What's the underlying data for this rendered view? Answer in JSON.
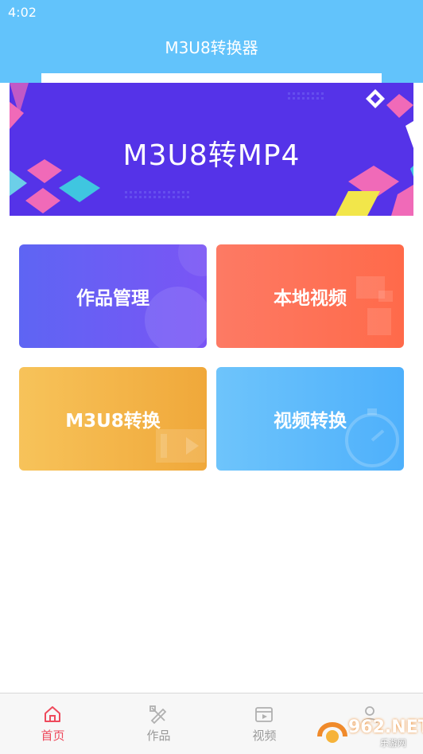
{
  "status_bar": {
    "time": "4:02"
  },
  "header": {
    "title": "M3U8转换器"
  },
  "banner": {
    "title": "M3U8转MP4"
  },
  "cards": [
    {
      "label": "作品管理",
      "color": "#6a5ff4"
    },
    {
      "label": "本地视频",
      "color": "#fe7257"
    },
    {
      "label": "M3U8转换",
      "color": "#f4b84a"
    },
    {
      "label": "视频转换",
      "color": "#5ebafb"
    }
  ],
  "tabbar": {
    "items": [
      {
        "label": "首页",
        "icon": "home-icon",
        "active": true
      },
      {
        "label": "作品",
        "icon": "works-icon",
        "active": false
      },
      {
        "label": "视频",
        "icon": "video-icon",
        "active": false
      },
      {
        "label": "",
        "icon": "user-icon",
        "active": false
      }
    ]
  },
  "watermark": {
    "text": "962.NET",
    "sub": "乐游网"
  },
  "colors": {
    "header": "#62c3fb",
    "banner": "#5533e8",
    "active_tab": "#ee4a5c"
  }
}
